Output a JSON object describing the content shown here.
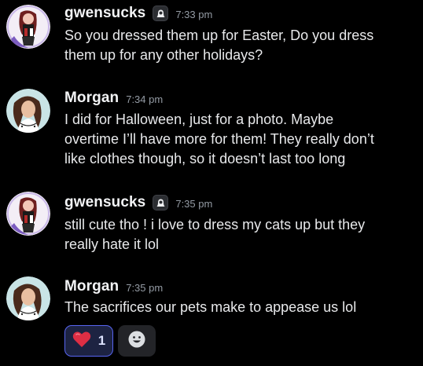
{
  "messages": [
    {
      "author": "gwensucks",
      "badge_icon": "server-tag-icon",
      "time": "7:33 pm",
      "lines": [
        "So you dressed them up for Easter, Do you dress",
        "them up for any other holidays?"
      ]
    },
    {
      "author": "Morgan",
      "time": "7:34 pm",
      "lines": [
        "I did for Halloween, just for a photo. Maybe",
        "overtime I’ll have more for them! They really don’t",
        "like clothes though, so it doesn’t last too long"
      ]
    },
    {
      "author": "gwensucks",
      "badge_icon": "server-tag-icon",
      "time": "7:35 pm",
      "lines": [
        "still cute tho ! i love to dress my cats up but they",
        "really hate it lol"
      ]
    },
    {
      "author": "Morgan",
      "time": "7:35 pm",
      "lines": [
        "The sacrifices our pets make to appease us lol"
      ]
    }
  ],
  "reactions": [
    {
      "emoji": "red-heart-icon",
      "count": "1",
      "selected": true
    }
  ],
  "add_reaction_icon": "smiley-add-reaction-icon",
  "colors": {
    "background": "#000000",
    "username": "#f2f3f5",
    "timestamp": "#949ba4",
    "message_text": "#e8e9eb",
    "reaction_border": "#5865f2",
    "reaction_bg": "#1d2342",
    "heart": "#dd2e44"
  }
}
